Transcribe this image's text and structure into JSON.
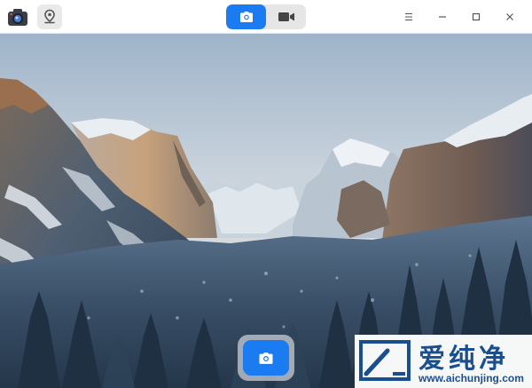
{
  "titlebar": {
    "app_icon": "camera-app-icon",
    "location_button_icon": "location-pin-icon",
    "modes": [
      {
        "name": "photo",
        "icon": "camera-icon",
        "active": true
      },
      {
        "name": "video",
        "icon": "video-camera-icon",
        "active": false
      }
    ],
    "window_controls": [
      "menu-icon",
      "minimize-icon",
      "maximize-icon",
      "close-icon"
    ]
  },
  "viewport": {
    "scene": "snowy-mountain-valley-preview"
  },
  "shutter": {
    "icon": "camera-icon"
  },
  "watermark": {
    "title": "爱纯净",
    "url": "www.aichunjing.com"
  },
  "colors": {
    "accent": "#1b7cf2",
    "titlebar_bg": "#ffffff",
    "watermark_text": "#1a4f8f"
  }
}
